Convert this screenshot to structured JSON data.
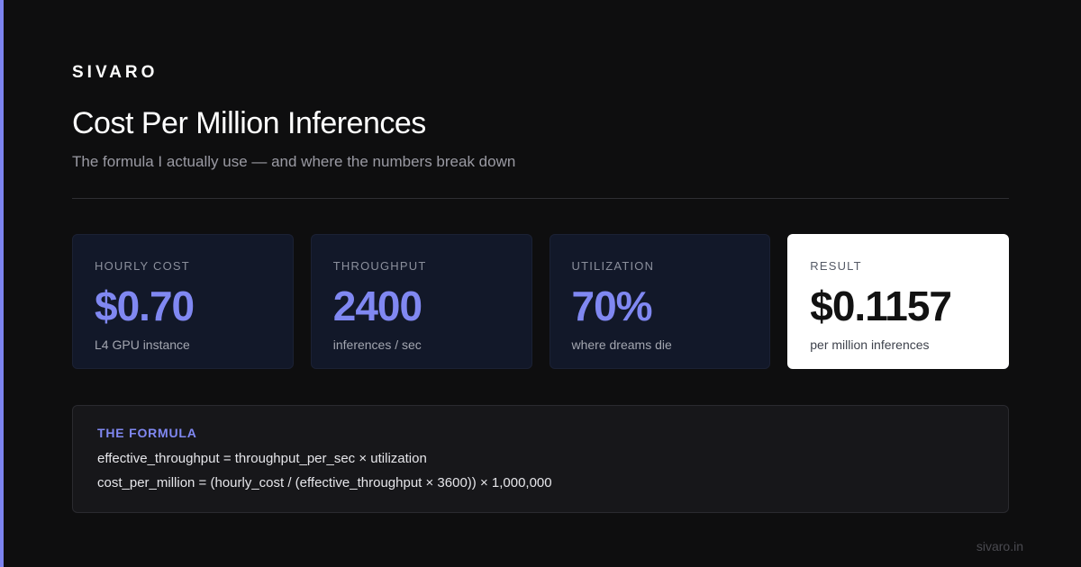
{
  "brand": "SIVARO",
  "title": "Cost Per Million Inferences",
  "subtitle": "The formula I actually use — and where the numbers break down",
  "cards": [
    {
      "label": "HOURLY COST",
      "value": "$0.70",
      "note": "L4 GPU instance"
    },
    {
      "label": "THROUGHPUT",
      "value": "2400",
      "note": "inferences / sec"
    },
    {
      "label": "UTILIZATION",
      "value": "70%",
      "note": "where dreams die"
    },
    {
      "label": "RESULT",
      "value": "$0.1157",
      "note": "per million inferences"
    }
  ],
  "formula": {
    "heading": "THE FORMULA",
    "line1": "effective_throughput = throughput_per_sec × utilization",
    "line2": "cost_per_million = (hourly_cost / (effective_throughput × 3600)) × 1,000,000"
  },
  "footer": "sivaro.in",
  "colors": {
    "accent": "#7c83f0",
    "background": "#0e0e0f",
    "card_background": "#121829",
    "result_card_background": "#ffffff"
  }
}
